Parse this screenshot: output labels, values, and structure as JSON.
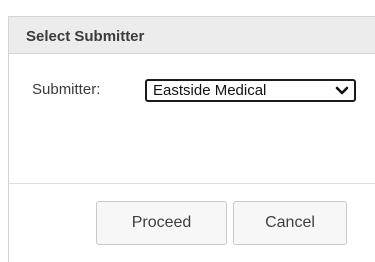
{
  "dialog": {
    "title": "Select Submitter",
    "submitter_label": "Submitter:",
    "submitter_select": {
      "selected": "Eastside Medical",
      "icon": "chevron-down-icon"
    },
    "buttons": {
      "proceed_label": "Proceed",
      "cancel_label": "Cancel"
    }
  },
  "colors": {
    "header_bg": "#ececec",
    "border": "#d4d4d4",
    "button_bg": "#f7f7f7",
    "select_border": "#1a1a1a"
  }
}
